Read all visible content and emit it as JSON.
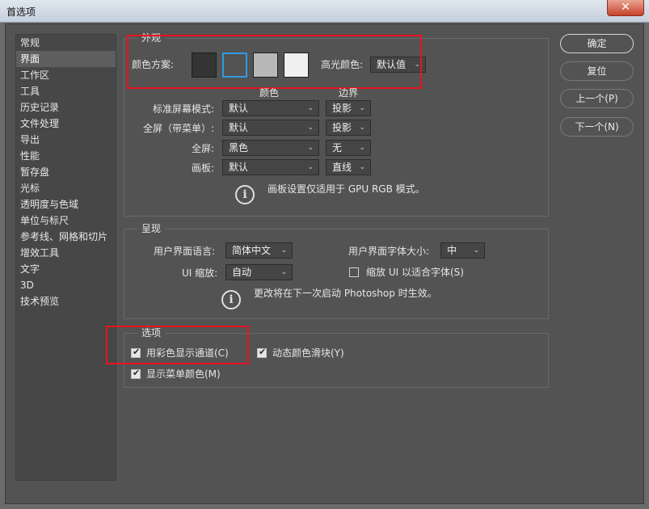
{
  "window": {
    "title": "首选项",
    "close": "✕"
  },
  "sidebar": {
    "items": [
      "常规",
      "界面",
      "工作区",
      "工具",
      "历史记录",
      "文件处理",
      "导出",
      "性能",
      "暂存盘",
      "光标",
      "透明度与色域",
      "单位与标尺",
      "参考线、网格和切片",
      "增效工具",
      "文字",
      "3D",
      "技术预览"
    ],
    "active_index": 1
  },
  "appearance": {
    "legend": "外观",
    "color_scheme_label": "颜色方案:",
    "swatches": [
      "#343434",
      "#535353",
      "#b8b8b8",
      "#f0f0f0"
    ],
    "selected_swatch": 1,
    "highlight_label": "高光颜色:",
    "highlight_value": "默认值",
    "col_color": "颜色",
    "col_border": "边界",
    "rows": [
      {
        "label": "标准屏幕模式:",
        "color": "默认",
        "border": "投影"
      },
      {
        "label": "全屏（带菜单）:",
        "color": "默认",
        "border": "投影"
      },
      {
        "label": "全屏:",
        "color": "黑色",
        "border": "无"
      },
      {
        "label": "画板:",
        "color": "默认",
        "border": "直线"
      }
    ],
    "note": "画板设置仅适用于 GPU RGB 模式。"
  },
  "render": {
    "legend": "呈现",
    "lang_label": "用户界面语言:",
    "lang_value": "简体中文",
    "font_size_label": "用户界面字体大小:",
    "font_size_value": "中",
    "scale_label": "UI 缩放:",
    "scale_value": "自动",
    "scale_font_checkbox": "缩放 UI 以适合字体(S)",
    "note": "更改将在下一次启动 Photoshop 时生效。"
  },
  "options": {
    "legend": "选项",
    "color_channels": "用彩色显示通道(C)",
    "dynamic_sliders": "动态颜色滑块(Y)",
    "menu_colors": "显示菜单颜色(M)"
  },
  "buttons": {
    "ok": "确定",
    "reset": "复位",
    "prev": "上一个(P)",
    "next": "下一个(N)"
  }
}
